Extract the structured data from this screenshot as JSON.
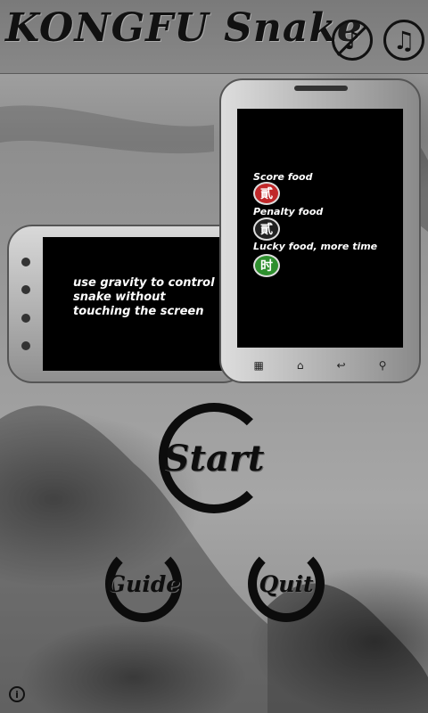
{
  "app": {
    "title": "KONGFU Snake"
  },
  "header": {
    "music_off_icon": "music-note-off-icon",
    "music_on_icon": "music-note-on-icon"
  },
  "guide_left": {
    "text": "use gravity to control snake without touching the screen"
  },
  "guide_right": {
    "score_label": "Score food",
    "score_char": "貳",
    "penalty_label": "Penalty food",
    "penalty_char": "貳",
    "lucky_label": "Lucky food, more time",
    "lucky_char": "时"
  },
  "menu": {
    "start": "Start",
    "guide": "Guide",
    "quit": "Quit"
  },
  "footer": {
    "info_icon": "info-icon"
  },
  "colors": {
    "score": "#c0282a",
    "penalty": "#222222",
    "lucky": "#2e8f2e",
    "ink": "#0c0c0c"
  }
}
